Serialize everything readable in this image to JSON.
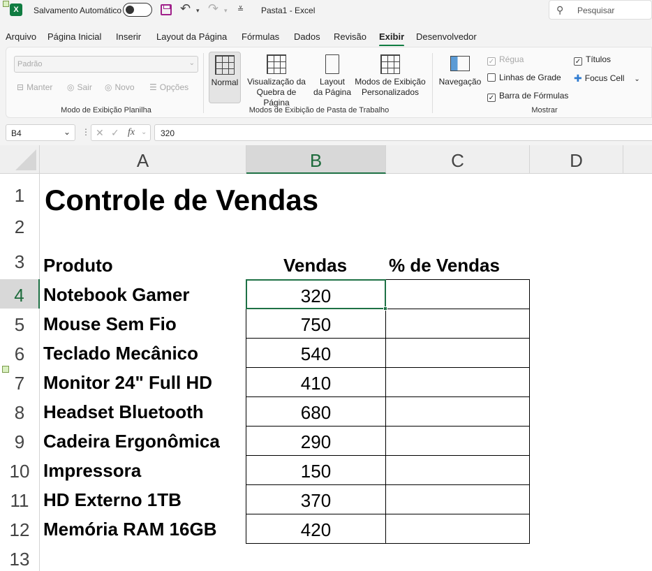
{
  "titlebar": {
    "app_icon": "excel-icon",
    "autosave_label": "Salvamento Automático",
    "file_title": "Pasta1 - Excel",
    "search_placeholder": "Pesquisar"
  },
  "menu": {
    "tabs": [
      "Arquivo",
      "Página Inicial",
      "Inserir",
      "Layout da Página",
      "Fórmulas",
      "Dados",
      "Revisão",
      "Exibir",
      "Desenvolvedor"
    ],
    "active_tab": "Exibir"
  },
  "ribbon": {
    "sheet_view": {
      "combo_value": "Padrão",
      "buttons": [
        "Manter",
        "Sair",
        "Novo",
        "Opções"
      ],
      "label": "Modo de Exibição Planilha"
    },
    "workbook_views": {
      "normal": "Normal",
      "page_break_1": "Visualização da",
      "page_break_2": "Quebra de Página",
      "page_layout_1": "Layout",
      "page_layout_2": "da Página",
      "custom_1": "Modos de Exibição",
      "custom_2": "Personalizados",
      "label": "Modos de Exibição de Pasta de Trabalho"
    },
    "show": {
      "navigation": "Navegação",
      "ruler": "Régua",
      "gridlines": "Linhas de Grade",
      "formula_bar": "Barra de Fórmulas",
      "headings": "Títulos",
      "focus_cell": "Focus Cell",
      "label": "Mostrar"
    }
  },
  "formula_bar": {
    "name_box": "B4",
    "fx": "fx",
    "value": "320"
  },
  "grid": {
    "columns": [
      "A",
      "B",
      "C",
      "D"
    ],
    "rows": [
      "1",
      "2",
      "3",
      "4",
      "5",
      "6",
      "7",
      "8",
      "9",
      "10",
      "11",
      "12",
      "13"
    ],
    "title": "Controle de Vendas",
    "headers": {
      "produto": "Produto",
      "vendas": "Vendas",
      "pct": "% de Vendas"
    },
    "items": [
      {
        "produto": "Notebook Gamer",
        "vendas": "320"
      },
      {
        "produto": "Mouse Sem Fio",
        "vendas": "750"
      },
      {
        "produto": "Teclado Mecânico",
        "vendas": "540"
      },
      {
        "produto": "Monitor 24\" Full HD",
        "vendas": "410"
      },
      {
        "produto": "Headset Bluetooth",
        "vendas": "680"
      },
      {
        "produto": "Cadeira Ergonômica",
        "vendas": "290"
      },
      {
        "produto": "Impressora",
        "vendas": "150"
      },
      {
        "produto": "HD Externo 1TB",
        "vendas": "370"
      },
      {
        "produto": "Memória RAM 16GB",
        "vendas": "420"
      }
    ]
  },
  "colors": {
    "accent_green": "#107c41",
    "selection_green": "#1e7145"
  }
}
